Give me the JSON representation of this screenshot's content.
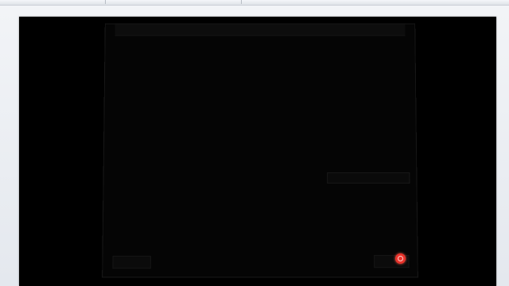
{
  "toolbar": {
    "field1": "",
    "field2": "",
    "field3": ""
  },
  "document": {
    "content": ""
  },
  "dialog": {
    "title": "",
    "left_button": "",
    "right_button": ""
  },
  "colors": {
    "record_indicator": "#e8332b",
    "document_background": "#000000"
  },
  "icons": {
    "record": "record-icon",
    "logo": "logo-icon"
  }
}
